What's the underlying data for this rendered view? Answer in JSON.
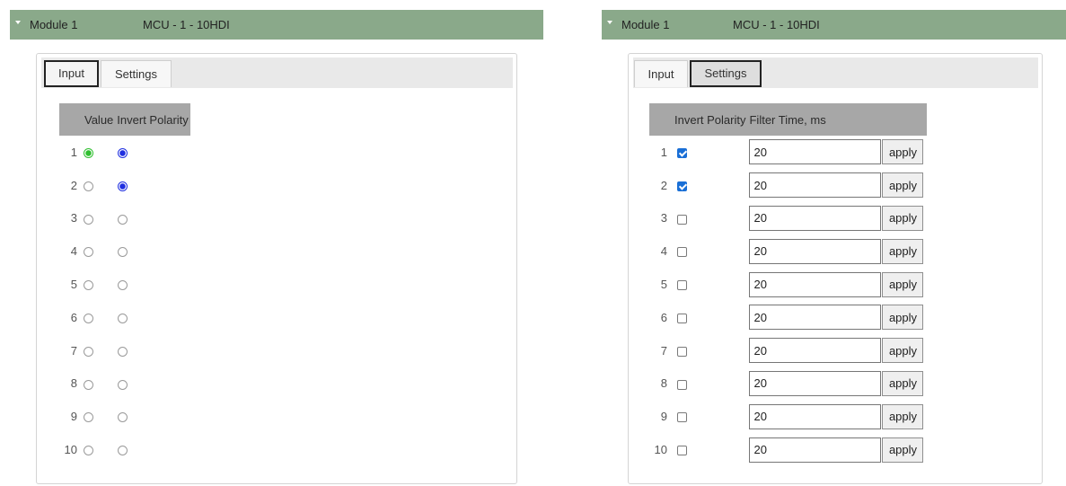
{
  "left_module": {
    "name": "Module 1",
    "type": "MCU - 1 - 10HDI",
    "tabs": [
      {
        "label": "Input",
        "active": true
      },
      {
        "label": "Settings",
        "active": false
      }
    ],
    "columns": [
      "",
      "Value",
      "Invert Polarity"
    ],
    "rows": [
      {
        "num": "1",
        "value": true,
        "invert": true
      },
      {
        "num": "2",
        "value": false,
        "invert": true
      },
      {
        "num": "3",
        "value": false,
        "invert": false
      },
      {
        "num": "4",
        "value": false,
        "invert": false
      },
      {
        "num": "5",
        "value": false,
        "invert": false
      },
      {
        "num": "6",
        "value": false,
        "invert": false
      },
      {
        "num": "7",
        "value": false,
        "invert": false
      },
      {
        "num": "8",
        "value": false,
        "invert": false
      },
      {
        "num": "9",
        "value": false,
        "invert": false
      },
      {
        "num": "10",
        "value": false,
        "invert": false
      }
    ]
  },
  "right_module": {
    "name": "Module 1",
    "type": "MCU - 1 - 10HDI",
    "tabs": [
      {
        "label": "Input",
        "active": false
      },
      {
        "label": "Settings",
        "active": true
      }
    ],
    "columns": [
      "",
      "Invert Polarity",
      "Filter Time, ms"
    ],
    "apply_label": "apply",
    "rows": [
      {
        "num": "1",
        "invert": true,
        "filter": "20"
      },
      {
        "num": "2",
        "invert": true,
        "filter": "20"
      },
      {
        "num": "3",
        "invert": false,
        "filter": "20"
      },
      {
        "num": "4",
        "invert": false,
        "filter": "20"
      },
      {
        "num": "5",
        "invert": false,
        "filter": "20"
      },
      {
        "num": "6",
        "invert": false,
        "filter": "20"
      },
      {
        "num": "7",
        "invert": false,
        "filter": "20"
      },
      {
        "num": "8",
        "invert": false,
        "filter": "20"
      },
      {
        "num": "9",
        "invert": false,
        "filter": "20"
      },
      {
        "num": "10",
        "invert": false,
        "filter": "20"
      }
    ]
  },
  "colors": {
    "header_bg": "#8aa98a",
    "value_on": "#2fbf2f",
    "invert_on": "#1f2fe0",
    "checkbox_on": "#1a6fd6",
    "table_header_bg": "#a7a7a7"
  }
}
